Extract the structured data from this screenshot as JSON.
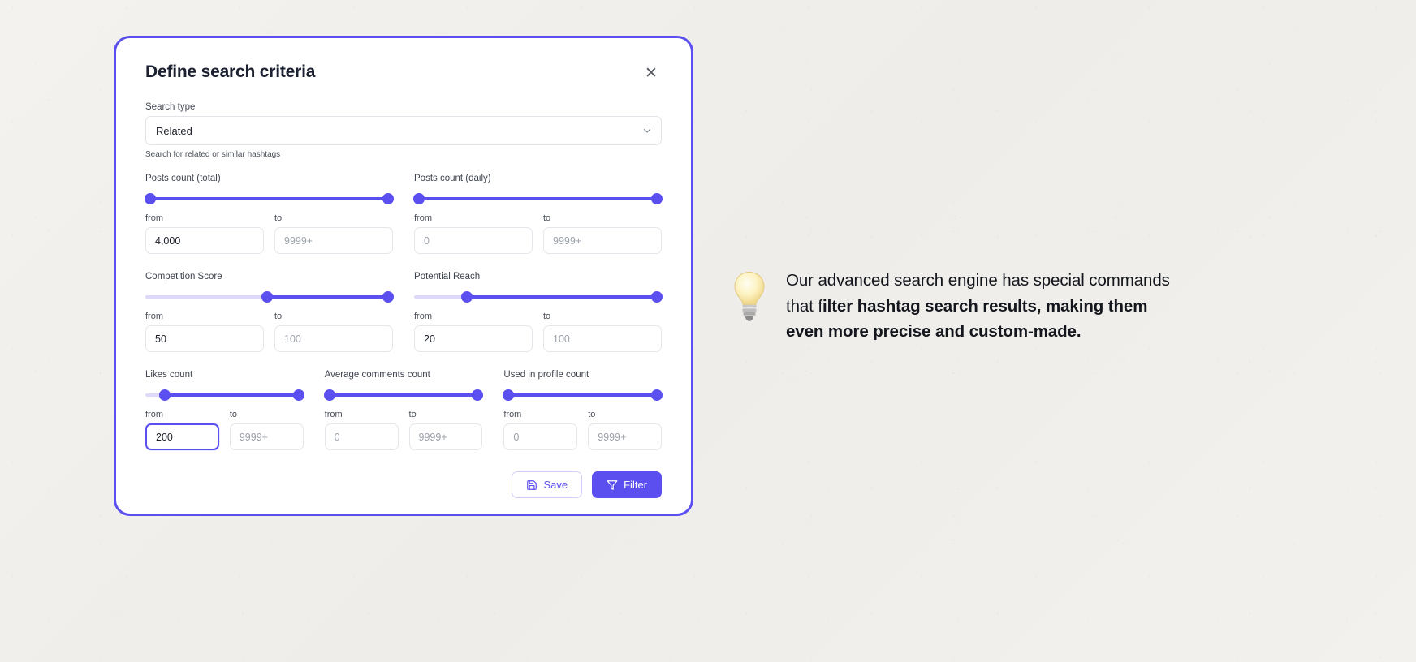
{
  "modal": {
    "title": "Define search criteria",
    "close_icon": "close-icon",
    "search_type": {
      "label": "Search type",
      "value": "Related",
      "chevron_icon": "chevron-down-icon",
      "helper": "Search for related or similar hashtags"
    },
    "from_label": "from",
    "to_label": "to",
    "groups": [
      {
        "name": "Posts count (total)",
        "slider": {
          "inactive_left_pct": 0,
          "start_pct": 0,
          "end_pct": 100
        },
        "from": {
          "value": "4,000",
          "placeholder": "0",
          "focused": false
        },
        "to": {
          "value": "",
          "placeholder": "9999+",
          "focused": false
        }
      },
      {
        "name": "Posts count (daily)",
        "slider": {
          "inactive_left_pct": 0,
          "start_pct": 0,
          "end_pct": 100
        },
        "from": {
          "value": "",
          "placeholder": "0",
          "focused": false
        },
        "to": {
          "value": "",
          "placeholder": "9999+",
          "focused": false
        }
      },
      {
        "name": "Competition Score",
        "slider": {
          "inactive_left_pct": 0,
          "start_pct": 49,
          "end_pct": 100
        },
        "from": {
          "value": "50",
          "placeholder": "0",
          "focused": false
        },
        "to": {
          "value": "",
          "placeholder": "100",
          "focused": false
        }
      },
      {
        "name": "Potential Reach",
        "slider": {
          "inactive_left_pct": 0,
          "start_pct": 20,
          "end_pct": 100
        },
        "from": {
          "value": "20",
          "placeholder": "0",
          "focused": false
        },
        "to": {
          "value": "",
          "placeholder": "100",
          "focused": false
        }
      },
      {
        "name": "Likes count",
        "slider": {
          "inactive_left_pct": 0,
          "start_pct": 10,
          "end_pct": 100
        },
        "from": {
          "value": "200",
          "placeholder": "0",
          "focused": true
        },
        "to": {
          "value": "",
          "placeholder": "9999+",
          "focused": false
        }
      },
      {
        "name": "Average comments count",
        "slider": {
          "inactive_left_pct": 0,
          "start_pct": 0,
          "end_pct": 100
        },
        "from": {
          "value": "",
          "placeholder": "0",
          "focused": false
        },
        "to": {
          "value": "",
          "placeholder": "9999+",
          "focused": false
        }
      },
      {
        "name": "Used in profile count",
        "slider": {
          "inactive_left_pct": 0,
          "start_pct": 0,
          "end_pct": 100
        },
        "from": {
          "value": "",
          "placeholder": "0",
          "focused": false
        },
        "to": {
          "value": "",
          "placeholder": "9999+",
          "focused": false
        }
      }
    ],
    "footer": {
      "save_label": "Save",
      "save_icon": "floppy-disk-icon",
      "filter_label": "Filter",
      "filter_icon": "funnel-icon"
    }
  },
  "tip": {
    "icon": "light-bulb-icon",
    "text_plain": "Our advanced search engine has special commands that f",
    "text_bold": "ilter hashtag search results, making them even more precise and custom-made."
  },
  "colors": {
    "accent": "#5b4ff0",
    "track_inactive": "#ded9f8",
    "text_dark": "#1b2130",
    "placeholder": "#9ba0a9",
    "page_bg": "#f2f0ec"
  }
}
